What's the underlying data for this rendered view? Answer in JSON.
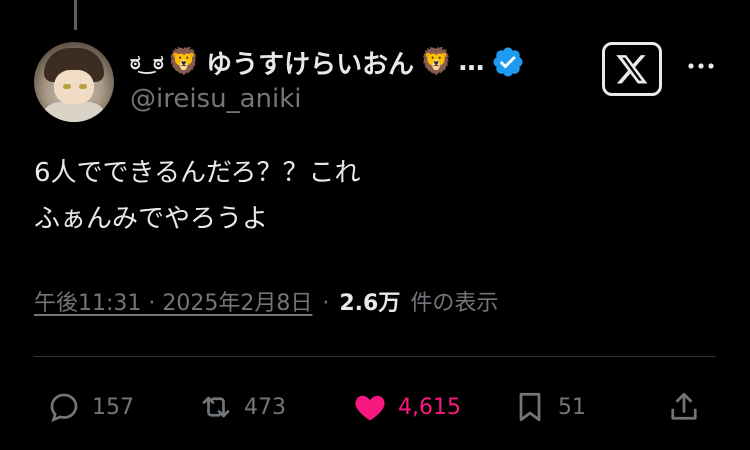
{
  "author": {
    "display_name_prefix": "ಠ‿ಠ",
    "display_name": "ゆうすけらいおん",
    "display_name_suffix": "…",
    "handle": "@ireisu_aniki",
    "verified": true,
    "verified_color": "#1d9bf0"
  },
  "tweet": {
    "text": "6人でできるんだろ？？これ\nふぁんみでやろうよ"
  },
  "meta": {
    "timestamp": "午後11:31 · 2025年2月8日",
    "separator": "·",
    "views_count": "2.6万",
    "views_label": "件の表示"
  },
  "actions": {
    "replies": "157",
    "retweets": "473",
    "likes": "4,615",
    "bookmarks": "51",
    "like_color": "#f91880"
  },
  "icons": [
    "reply-icon",
    "retweet-icon",
    "heart-icon",
    "bookmark-icon",
    "share-icon",
    "x-logo-icon",
    "more-icon",
    "verified-icon"
  ]
}
